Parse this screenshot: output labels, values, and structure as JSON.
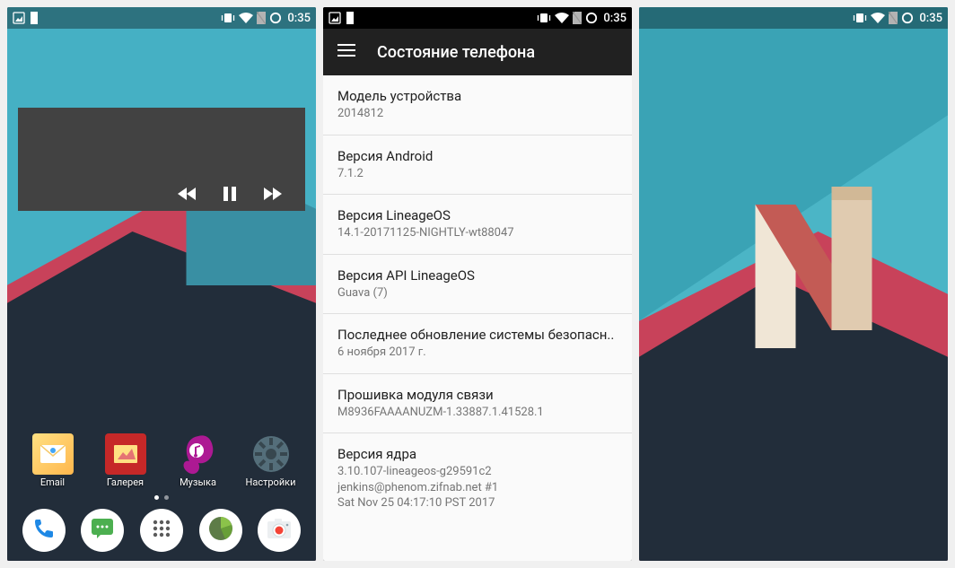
{
  "status": {
    "time": "0:35"
  },
  "home": {
    "apps": [
      {
        "label": "Email",
        "icon": "email-icon"
      },
      {
        "label": "Галерея",
        "icon": "gallery-icon"
      },
      {
        "label": "Музыка",
        "icon": "music-icon"
      },
      {
        "label": "Настройки",
        "icon": "settings-icon"
      }
    ],
    "dock": [
      {
        "icon": "phone-icon"
      },
      {
        "icon": "messages-icon"
      },
      {
        "icon": "app-drawer-icon"
      },
      {
        "icon": "browser-icon"
      },
      {
        "icon": "camera-icon"
      }
    ]
  },
  "settings": {
    "title": "Состояние телефона",
    "items": [
      {
        "title": "Модель устройства",
        "value": "2014812"
      },
      {
        "title": "Версия Android",
        "value": "7.1.2"
      },
      {
        "title": "Версия LineageOS",
        "value": "14.1-20171125-NIGHTLY-wt88047"
      },
      {
        "title": "Версия API LineageOS",
        "value": "Guava (7)"
      },
      {
        "title": "Последнее обновление системы безопасн..",
        "value": "6 ноября 2017 г."
      },
      {
        "title": "Прошивка модуля связи",
        "value": "M8936FAAAANUZM-1.33887.1.41528.1"
      },
      {
        "title": "Версия ядра",
        "value": "3.10.107-lineageos-g29591c2\njenkins@phenom.zifnab.net #1\nSat Nov 25 04:17:10 PST 2017"
      }
    ]
  }
}
